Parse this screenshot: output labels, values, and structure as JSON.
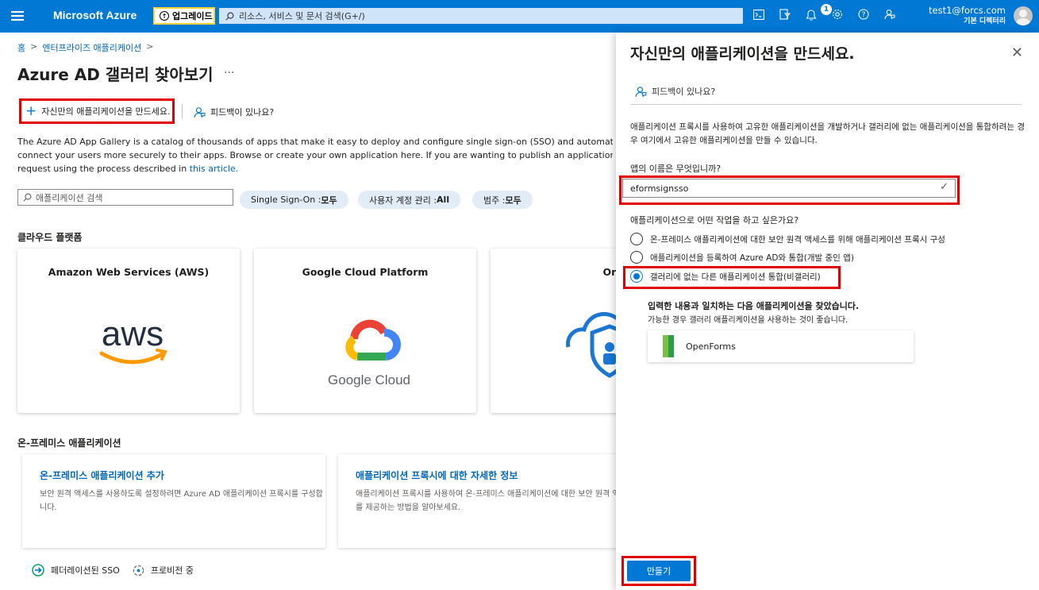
{
  "topbar": {
    "brand": "Microsoft Azure",
    "upgrade_label": "업그레이드",
    "search_placeholder": "리소스, 서비스 및 문서 검색(G+/)",
    "notification_count": "1",
    "user_email": "test1@forcs.com",
    "user_directory": "기본 디렉터리",
    "icons": [
      "cloud-shell-icon",
      "directory-filter-icon",
      "notification-icon",
      "settings-icon",
      "help-icon",
      "feedback-icon"
    ]
  },
  "breadcrumb": {
    "home": "홈",
    "enterprise_apps": "엔터프라이즈 애플리케이션",
    "sep": ">"
  },
  "page": {
    "title": "Azure AD 갤러리 찾아보기",
    "more": "...",
    "create_button": "자신만의 애플리케이션을 만드세요.",
    "feedback_label": "피드백이 있나요?",
    "description_line1": "The Azure AD App Gallery is a catalog of thousands of apps that make it easy to deploy and configure single sign-on (SSO) and automated user pr",
    "description_line2": "connect your users more securely to their apps. Browse or create your own application here. If you are wanting to publish an application you have",
    "description_line3": "request using the process described in ",
    "description_link": "this article.",
    "app_search_placeholder": "애플리케이션 검색"
  },
  "filters": [
    {
      "label": "Single Sign-On : ",
      "value": "모두"
    },
    {
      "label": "사용자 계정 관리 : ",
      "value": "All"
    },
    {
      "label": "범주 : ",
      "value": "모두"
    }
  ],
  "cloud_section": {
    "heading": "클라우드 플랫폼",
    "cards": [
      {
        "title": "Amazon Web Services (AWS)",
        "logo_text": "aws"
      },
      {
        "title": "Google Cloud Platform",
        "logo_text": "Google Cloud"
      },
      {
        "title": "Oracl"
      }
    ]
  },
  "onprem_section": {
    "heading": "온-프레미스 애플리케이션",
    "cards": [
      {
        "title": "온-프레미스 애플리케이션 추가",
        "body": "보안 원격 액세스를 사용하도록 설정하려면 Azure AD 애플리케이션 프록시를 구성합니다."
      },
      {
        "title": "애플리케이션 프록시에 대한 자세한 정보",
        "body": "애플리케이션 프록시를 사용하여 온-프레미스 애플리케이션에 대한 보안 원격 액세스를 제공하는 방법을 알아보세요."
      }
    ]
  },
  "footer": {
    "federated": "페더레이션된 SSO",
    "provisioning": "프로비전 중"
  },
  "panel": {
    "title": "자신만의 애플리케이션을 만드세요.",
    "close": "✕",
    "feedback": "피드백이 있나요?",
    "description": "애플리케이션 프록시를 사용하여 고유한 애플리케이션을 개발하거나 갤러리에 없는 애플리케이션을 통합하려는 경우 여기에서 고유한 애플리케이션을 만들 수 있습니다.",
    "name_label": "앱의 이름은 무엇입니까?",
    "name_value": "eformsignsso",
    "purpose_label": "애플리케이션으로 어떤 작업을 하고 싶은가요?",
    "options": [
      {
        "label": "온-프레미스 애플리케이션에 대한 보안 원격 액세스를 위해 애플리케이션 프록시 구성",
        "selected": false
      },
      {
        "label": "애플리케이션을 등록하여 Azure AD와 통합(개발 중인 앱)",
        "selected": false
      },
      {
        "label": "갤러리에 없는 다른 애플리케이션 통합(비갤러리)",
        "selected": true
      }
    ],
    "match_heading": "입력한 내용과 일치하는 다음 애플리케이션을 찾았습니다.",
    "match_sub": "가능한 경우 갤러리 애플리케이션을 사용하는 것이 좋습니다.",
    "suggestion": "OpenForms",
    "create_button": "만들기"
  }
}
